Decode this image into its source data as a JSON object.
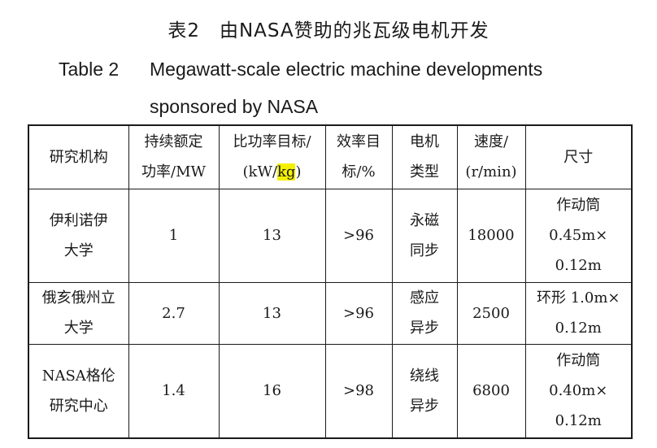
{
  "caption": {
    "cn": "表2　由NASA赞助的兆瓦级电机开发",
    "en_label": "Table 2",
    "en_line1": "Megawatt-scale electric machine developments",
    "en_line2": "sponsored by NASA"
  },
  "table": {
    "headers": [
      [
        "研究机构"
      ],
      [
        "持续额定",
        "功率/MW"
      ],
      [
        "比功率目标/",
        "(kW/kg)"
      ],
      [
        "效率目",
        "标/%"
      ],
      [
        "电机",
        "类型"
      ],
      [
        "速度/",
        "(r/min)"
      ],
      [
        "尺寸"
      ]
    ],
    "header_highlight_text": "kg",
    "rows": [
      {
        "institution": [
          "伊利诺伊",
          "大学"
        ],
        "power": "1",
        "specific_power": "13",
        "efficiency": ">96",
        "type": [
          "永磁",
          "同步"
        ],
        "speed": "18000",
        "size": [
          "作动筒",
          "0.45m×",
          "0.12m"
        ]
      },
      {
        "institution": [
          "俄亥俄州立",
          "大学"
        ],
        "power": "2.7",
        "specific_power": "13",
        "efficiency": ">96",
        "type": [
          "感应",
          "异步"
        ],
        "speed": "2500",
        "size": [
          "环形 1.0m×",
          "0.12m"
        ]
      },
      {
        "institution": [
          "NASA格伦",
          "研究中心"
        ],
        "power": "1.4",
        "specific_power": "16",
        "efficiency": ">98",
        "type": [
          "绕线",
          "异步"
        ],
        "speed": "6800",
        "size": [
          "作动筒",
          "0.40m×",
          "0.12m"
        ]
      }
    ]
  }
}
